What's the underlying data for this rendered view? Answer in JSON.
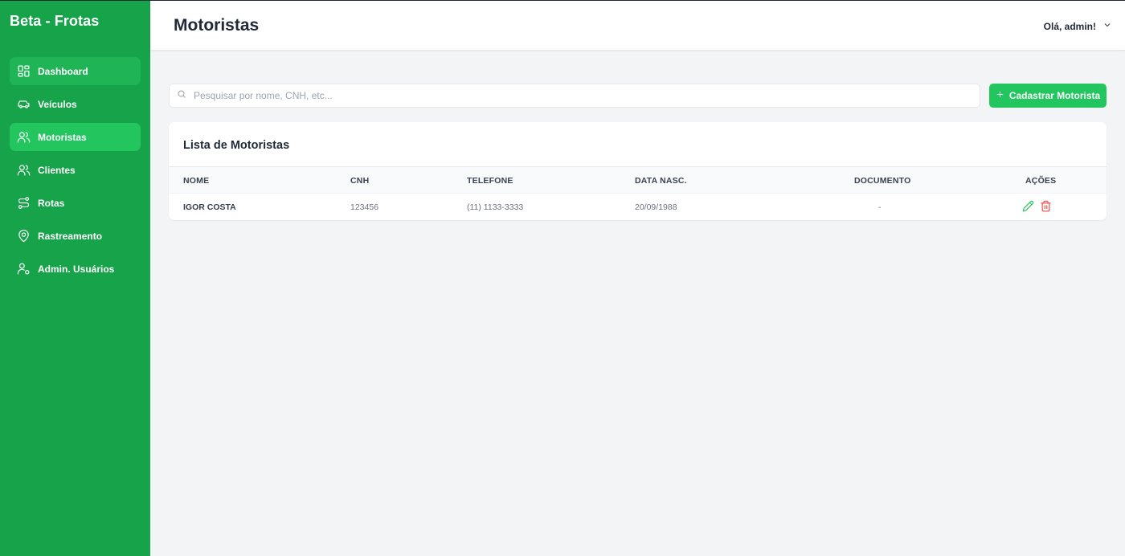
{
  "app": {
    "brand": "Beta - Frotas"
  },
  "sidebar": {
    "items": [
      {
        "label": "Dashboard",
        "icon": "dashboard-icon"
      },
      {
        "label": "Veículos",
        "icon": "car-icon"
      },
      {
        "label": "Motoristas",
        "icon": "users-icon",
        "active": true
      },
      {
        "label": "Clientes",
        "icon": "users-icon"
      },
      {
        "label": "Rotas",
        "icon": "route-icon"
      },
      {
        "label": "Rastreamento",
        "icon": "map-pin-icon"
      },
      {
        "label": "Admin. Usuários",
        "icon": "user-cog-icon"
      }
    ]
  },
  "header": {
    "title": "Motoristas",
    "greeting": "Olá, admin!"
  },
  "search": {
    "placeholder": "Pesquisar por nome, CNH, etc..."
  },
  "actions": {
    "add_label": "Cadastrar Motorista"
  },
  "table": {
    "title": "Lista de Motoristas",
    "columns": [
      "NOME",
      "CNH",
      "TELEFONE",
      "DATA NASC.",
      "DOCUMENTO",
      "AÇÕES"
    ],
    "rows": [
      {
        "nome": "IGOR COSTA",
        "cnh": "123456",
        "telefone": "(11) 1133-3333",
        "data_nasc": "20/09/1988",
        "documento": "-"
      }
    ]
  },
  "colors": {
    "sidebar": "#16a34a",
    "accent": "#22c55e",
    "danger": "#ef4444",
    "background": "#f3f4f6"
  }
}
